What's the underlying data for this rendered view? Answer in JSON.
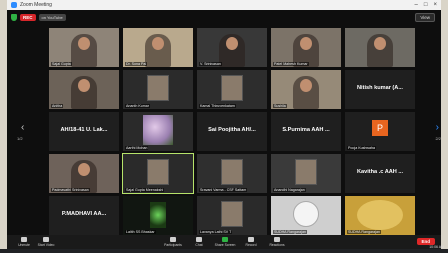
{
  "window": {
    "title": "Zoom Meeting"
  },
  "topbar": {
    "rec": "REC",
    "live": "on YouTube",
    "view": "View"
  },
  "tiles": [
    {
      "id": "r1c1",
      "name": "Sajal Gupta",
      "center": "",
      "bg": "#8e8478",
      "art": "person-glasses"
    },
    {
      "id": "r1c2",
      "name": "Dr. Sona Pal",
      "center": "",
      "bg": "#b9a98d",
      "art": "person-woman"
    },
    {
      "id": "r1c3",
      "name": "V. Srinivasan",
      "center": "",
      "bg": "#383838",
      "art": "person-small"
    },
    {
      "id": "r1c4",
      "name": "Patel Mahesh Kumar",
      "center": "",
      "bg": "#7c7368",
      "art": "person-room"
    },
    {
      "id": "r1c5",
      "name": "",
      "center": "",
      "bg": "#6d6a63",
      "art": "person-woman2"
    },
    {
      "id": "r2c1",
      "name": "Anitha",
      "center": "",
      "bg": "#6c6258",
      "art": "person-room2"
    },
    {
      "id": "r2c2",
      "name": "Ananth Kumar",
      "center": "",
      "bg": "#2b2b2b",
      "art": "photo-man"
    },
    {
      "id": "r2c3",
      "name": "Kamal Thiruvenkatam",
      "center": "",
      "bg": "#2d2d2d",
      "art": "photo-couple"
    },
    {
      "id": "r2c4",
      "name": "Sushila",
      "center": "",
      "bg": "#968a78",
      "art": "person-woman3"
    },
    {
      "id": "r2c5",
      "name": "",
      "center": "Nitish kumar (A...",
      "bg": "#1f1f1f",
      "art": "none"
    },
    {
      "id": "r3c1",
      "name": "",
      "center": "AH/18-41 U. Lak...",
      "bg": "#1f1f1f",
      "art": "none"
    },
    {
      "id": "r3c2",
      "name": "Aarthi Mohan",
      "center": "",
      "bg": "#2a2a2a",
      "art": "flowers"
    },
    {
      "id": "r3c3",
      "name": "",
      "center": "Sai Poojitha AH/...",
      "bg": "#1f1f1f",
      "art": "none"
    },
    {
      "id": "r3c4",
      "name": "",
      "center": "S.Purnima AAH ...",
      "bg": "#1f1f1f",
      "art": "none"
    },
    {
      "id": "r3c5",
      "name": "Pooja Kushwaha",
      "center": "",
      "bg": "#1f1f1f",
      "art": "avatar-p",
      "avatar": "P"
    },
    {
      "id": "r4c1",
      "name": "Padmavathi Srinivasan",
      "center": "",
      "bg": "#6e625a",
      "art": "person-room3"
    },
    {
      "id": "r4c2",
      "name": "Sajal Gupta Meenakshi",
      "center": "",
      "bg": "#2a2a2a",
      "art": "photo-woman",
      "active": true
    },
    {
      "id": "r4c3",
      "name": "Sravani Varma - CSF Sattam",
      "center": "",
      "bg": "#2f2f2f",
      "art": "photo-dark"
    },
    {
      "id": "r4c4",
      "name": "Anandhi Nagarajan",
      "center": "",
      "bg": "#3a3a3a",
      "art": "photo-girl"
    },
    {
      "id": "r4c5",
      "name": "",
      "center": "Kavitha .c AAH ...",
      "bg": "#1f1f1f",
      "art": "none"
    },
    {
      "id": "r5c1",
      "name": "",
      "center": "P.MADHAVI     AA...",
      "bg": "#1f1f1f",
      "art": "none"
    },
    {
      "id": "r5c2",
      "name": "Lalith SS Bhaskar",
      "center": "",
      "bg": "#111611",
      "art": "plant"
    },
    {
      "id": "r5c3",
      "name": "Lavanya  Lathi SV T",
      "center": "",
      "bg": "#2a2a2a",
      "art": "photo-small"
    },
    {
      "id": "r5c4",
      "name": "SUDHA Rangarajan",
      "center": "",
      "bg": "#cfcfcf",
      "art": "dog"
    },
    {
      "id": "r5c5",
      "name": "SUDHA Rangarajan",
      "center": "",
      "bg": "#c8a03a",
      "art": "yellow"
    }
  ],
  "pages": {
    "left": "1/2",
    "right": "2/2"
  },
  "toolbar": {
    "left": [
      {
        "label": "Unmute",
        "icon": "mic-off-icon"
      },
      {
        "label": "Start Video",
        "icon": "video-off-icon"
      }
    ],
    "center": [
      {
        "label": "Participants",
        "icon": "participants-icon"
      },
      {
        "label": "Chat",
        "icon": "chat-icon"
      },
      {
        "label": "Share Screen",
        "icon": "share-screen-icon"
      },
      {
        "label": "Record",
        "icon": "record-icon"
      },
      {
        "label": "Reactions",
        "icon": "reactions-icon"
      }
    ],
    "end": "End"
  },
  "taskbar": {
    "clock": "10:06 AM"
  }
}
